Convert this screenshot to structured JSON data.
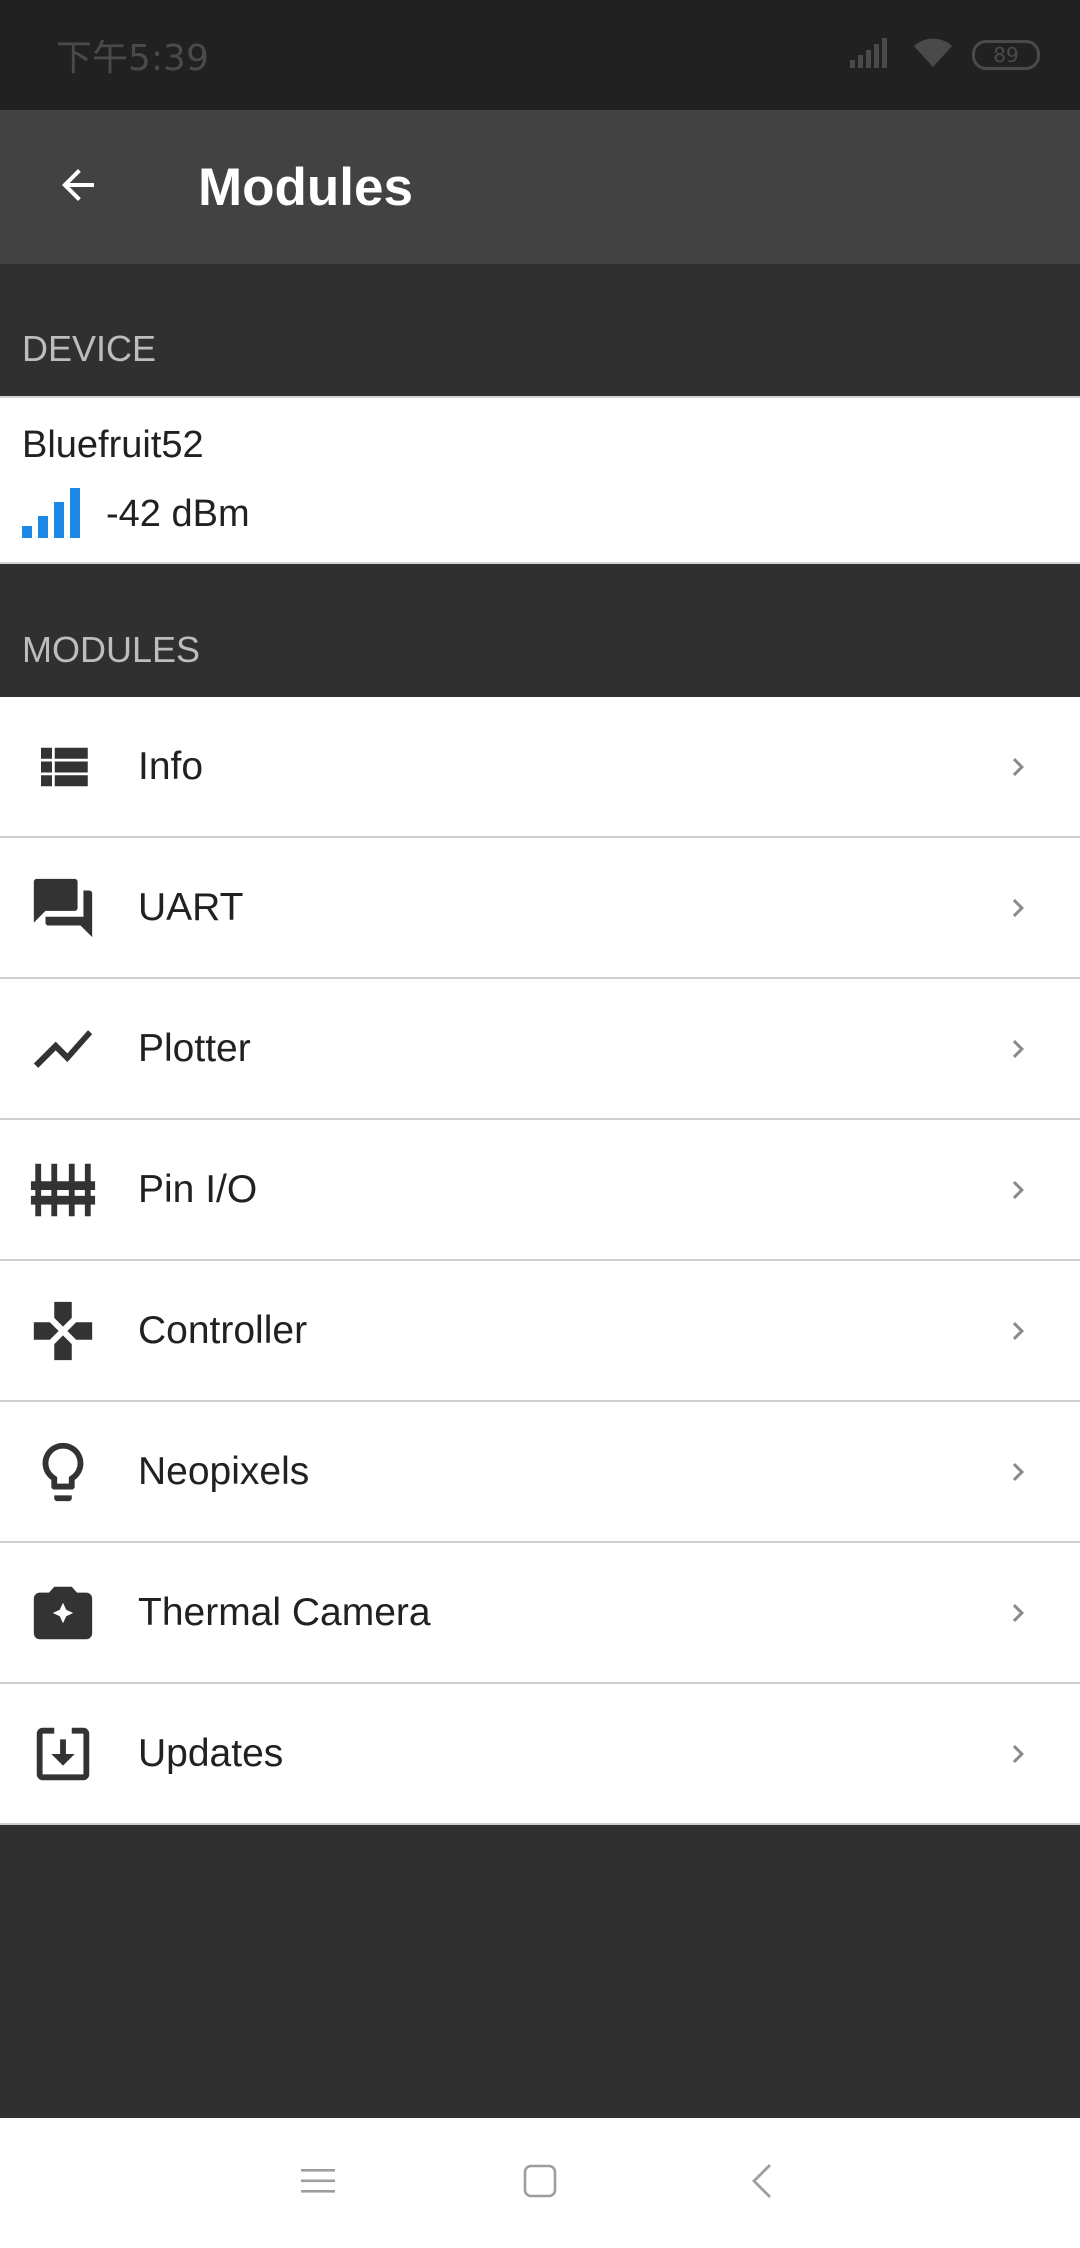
{
  "status_bar": {
    "time": "下午5:39",
    "battery": "89",
    "signal_icon": "signal-bars-icon",
    "wifi_icon": "wifi-icon"
  },
  "app_bar": {
    "title": "Modules",
    "back_icon": "arrow-back-icon"
  },
  "device_section": {
    "header": "DEVICE",
    "device_name": "Bluefruit52",
    "rssi": "-42 dBm",
    "rssi_icon": "signal-strength-icon",
    "rssi_color": "#1e88e5"
  },
  "modules_section": {
    "header": "MODULES",
    "items": [
      {
        "label": "Info",
        "icon": "list-icon"
      },
      {
        "label": "UART",
        "icon": "chat-icon"
      },
      {
        "label": "Plotter",
        "icon": "trending-line-icon"
      },
      {
        "label": "Pin I/O",
        "icon": "pins-icon"
      },
      {
        "label": "Controller",
        "icon": "gamepad-icon"
      },
      {
        "label": "Neopixels",
        "icon": "lightbulb-icon"
      },
      {
        "label": "Thermal Camera",
        "icon": "camera-icon"
      },
      {
        "label": "Updates",
        "icon": "download-box-icon"
      }
    ]
  },
  "nav_bar": {
    "menu_icon": "menu-icon",
    "home_icon": "home-square-icon",
    "back_icon": "back-chevron-icon"
  },
  "colors": {
    "app_bar": "#424242",
    "status_bar": "#212121",
    "background": "#303030",
    "accent": "#1e88e5"
  }
}
